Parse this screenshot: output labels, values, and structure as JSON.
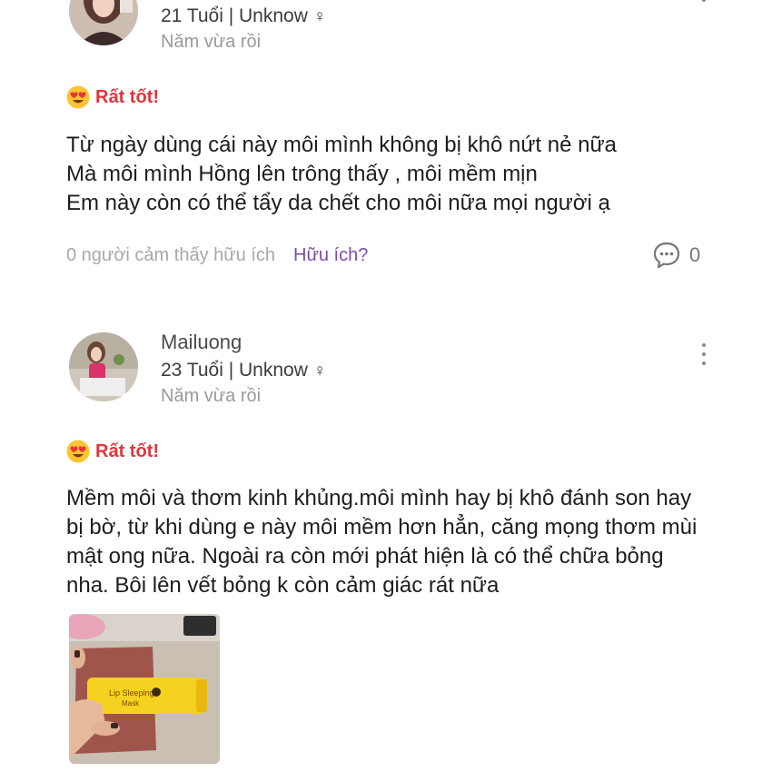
{
  "reviews": [
    {
      "username": "",
      "age_info": "21 Tuổi | Unknow",
      "gender": "♀",
      "time": "Năm vừa rồi",
      "rating": "Rất tốt!",
      "text": "Từ ngày dùng cái này môi mình không bị khô nứt nẻ nữa\nMà môi mình Hồng lên trông thấy , môi mềm mịn\nEm này còn có thể tẩy da chết cho môi nữa mọi người ạ",
      "helpful_count": "0 người cảm thấy hữu ích",
      "helpful_button": "Hữu ích?",
      "comment_count": "0"
    },
    {
      "username": "Mailuong",
      "age_info": "23 Tuổi | Unknow",
      "gender": "♀",
      "time": "Năm vừa rồi",
      "rating": "Rất tốt!",
      "text": "Mềm môi và thơm kinh khủng.môi mình hay bị khô đánh son hay\nbị bờ, từ khi dùng e này môi mềm hơn hẳn, căng mọng thơm mùi\nmật ong nữa. Ngoài ra còn mới phát hiện là có thể chữa bỏng\nnha. Bôi lên vết bỏng k còn cảm giác rát nữa",
      "photo_text": {
        "line1": "Lip Sleeping",
        "line2": "Mask"
      }
    }
  ],
  "colors": {
    "rating": "#e0353b",
    "helpful_link": "#7b4bb0",
    "muted": "#a8a8a8"
  },
  "icons": {
    "rating_emoji": "heart-eyes-emoji-icon",
    "comment": "comment-bubble-icon",
    "more": "vertical-dots-icon"
  }
}
